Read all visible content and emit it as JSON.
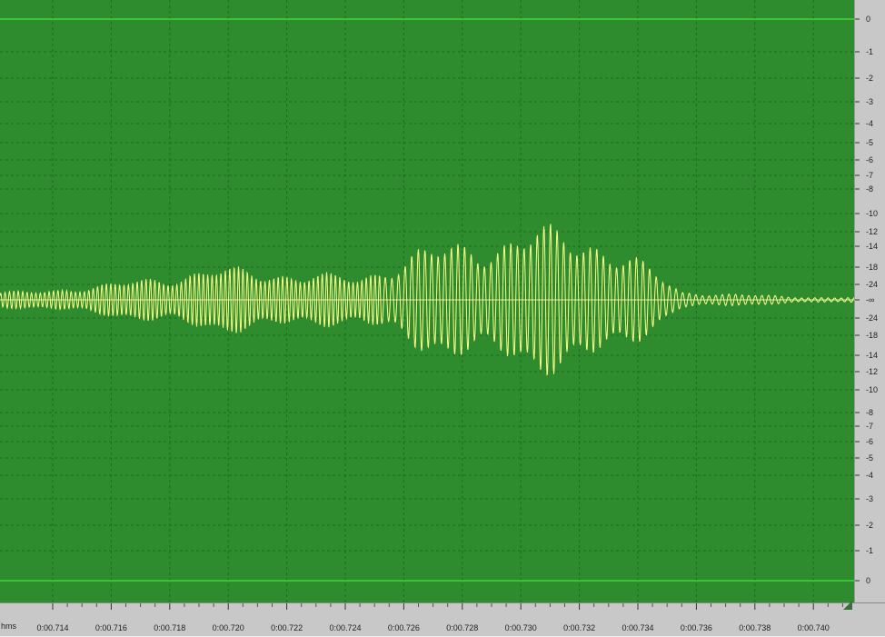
{
  "editor": {
    "time_unit_label": "hms",
    "colors": {
      "background": "#2e8b2e",
      "grid": "#1f6b1f",
      "waveform": "#ffff88",
      "center_line": "#e8e8b0",
      "boundary_line": "#44ff44",
      "ruler_bg": "#c8c8c8",
      "ruler_text": "#222222"
    }
  },
  "amplitude_ruler": {
    "labels": [
      "0",
      "-1",
      "-2",
      "-3",
      "-4",
      "-5",
      "-6",
      "-7",
      "-8",
      "-10",
      "-12",
      "-14",
      "-18",
      "-24",
      "-∞",
      "-24",
      "-18",
      "-14",
      "-12",
      "-10",
      "-8",
      "-7",
      "-6",
      "-5",
      "-4",
      "-3",
      "-2",
      "-1",
      "0"
    ]
  },
  "time_ruler": {
    "labels": [
      "0:00.714",
      "0:00.716",
      "0:00.718",
      "0:00.720",
      "0:00.722",
      "0:00.724",
      "0:00.726",
      "0:00.728",
      "0:00.730",
      "0:00.732",
      "0:00.734",
      "0:00.736",
      "0:00.738",
      "0:00.740"
    ]
  },
  "chart_data": {
    "type": "line",
    "x_range": [
      "0:00.7126",
      "0:00.7416"
    ],
    "y_scale": "dB",
    "envelope_peaks_db": [
      {
        "t": "0:00.713",
        "db": -30
      },
      {
        "t": "0:00.716",
        "db": -24
      },
      {
        "t": "0:00.7195",
        "db": -18
      },
      {
        "t": "0:00.722",
        "db": -19
      },
      {
        "t": "0:00.7245",
        "db": -21
      },
      {
        "t": "0:00.7265",
        "db": -14
      },
      {
        "t": "0:00.7285",
        "db": -13
      },
      {
        "t": "0:00.7305",
        "db": -11
      },
      {
        "t": "0:00.7325",
        "db": -12
      },
      {
        "t": "0:00.734",
        "db": -16
      },
      {
        "t": "0:00.7355",
        "db": -30
      },
      {
        "t": "0:00.740",
        "db": -40
      }
    ]
  }
}
